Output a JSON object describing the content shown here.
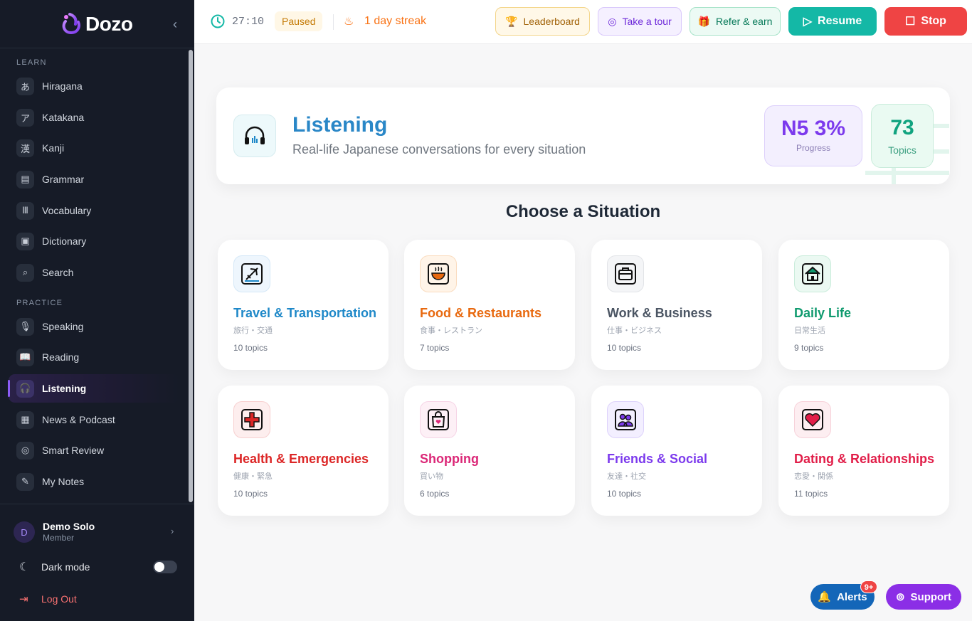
{
  "app": {
    "name": "Dozo"
  },
  "sidebar": {
    "learn_label": "LEARN",
    "practice_label": "PRACTICE",
    "learn_items": [
      {
        "label": "Hiragana",
        "glyph": "あ"
      },
      {
        "label": "Katakana",
        "glyph": "ア"
      },
      {
        "label": "Kanji",
        "glyph": "漢"
      },
      {
        "label": "Grammar",
        "glyph": "▤"
      },
      {
        "label": "Vocabulary",
        "glyph": "Ⅲ"
      },
      {
        "label": "Dictionary",
        "glyph": "▣"
      },
      {
        "label": "Search",
        "glyph": "⌕"
      }
    ],
    "practice_items": [
      {
        "label": "Speaking",
        "glyph": "🎙"
      },
      {
        "label": "Reading",
        "glyph": "📖"
      },
      {
        "label": "Listening",
        "glyph": "🎧"
      },
      {
        "label": "News & Podcast",
        "glyph": "▦"
      },
      {
        "label": "Smart Review",
        "glyph": "◎"
      },
      {
        "label": "My Notes",
        "glyph": "✎"
      }
    ],
    "active_item": "Listening",
    "user": {
      "initial": "D",
      "name": "Demo Solo",
      "role": "Member"
    },
    "dark_mode_label": "Dark mode",
    "dark_mode_on": false,
    "logout_label": "Log Out"
  },
  "topbar": {
    "timer": "27:10",
    "status": "Paused",
    "streak": "1 day streak",
    "buttons": {
      "leaderboard": "Leaderboard",
      "tour": "Take a tour",
      "refer": "Refer & earn",
      "resume": "Resume",
      "stop": "Stop"
    }
  },
  "hero": {
    "title": "Listening",
    "subtitle": "Real-life Japanese conversations for every situation",
    "progress_value": "N5 3%",
    "progress_label": "Progress",
    "topics_value": "73",
    "topics_label": "Topics"
  },
  "section_title": "Choose a Situation",
  "situations": [
    {
      "title": "Travel & Transportation",
      "jp": "旅行・交通",
      "count": "10 topics",
      "color": "#1e88c8",
      "icon": "airplane-icon"
    },
    {
      "title": "Food & Restaurants",
      "jp": "食事・レストラン",
      "count": "7 topics",
      "color": "#e8690f",
      "icon": "ramen-bowl-icon"
    },
    {
      "title": "Work & Business",
      "jp": "仕事・ビジネス",
      "count": "10 topics",
      "color": "#4b5563",
      "icon": "briefcase-icon"
    },
    {
      "title": "Daily Life",
      "jp": "日常生活",
      "count": "9 topics",
      "color": "#0f9a6e",
      "icon": "house-icon"
    },
    {
      "title": "Health & Emergencies",
      "jp": "健康・緊急",
      "count": "10 topics",
      "color": "#dc2626",
      "icon": "first-aid-icon"
    },
    {
      "title": "Shopping",
      "jp": "買い物",
      "count": "6 topics",
      "color": "#db2777",
      "icon": "shopping-bag-icon"
    },
    {
      "title": "Friends & Social",
      "jp": "友達・社交",
      "count": "10 topics",
      "color": "#7c3aed",
      "icon": "people-icon"
    },
    {
      "title": "Dating & Relationships",
      "jp": "恋愛・関係",
      "count": "11 topics",
      "color": "#e11d48",
      "icon": "heart-icon"
    }
  ],
  "floating": {
    "alerts": "Alerts",
    "alerts_badge": "9+",
    "support": "Support"
  }
}
